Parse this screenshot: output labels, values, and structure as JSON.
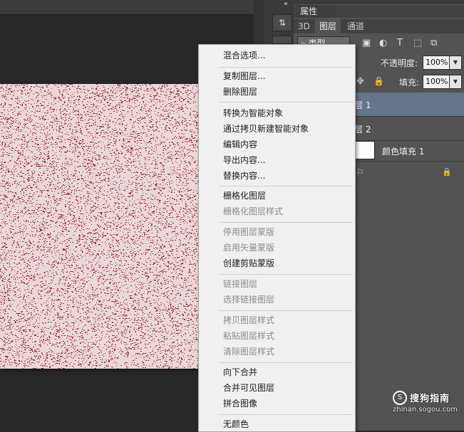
{
  "panel": {
    "props_tab": "属性",
    "tabs": [
      "3D",
      "图层",
      "通道"
    ],
    "filter_label": "类型",
    "opacity_label": "不透明度:",
    "opacity_value": "100%",
    "fill_label": "填充:",
    "fill_value": "100%",
    "layers": [
      "层 1",
      "层 2",
      "颜色填充 1"
    ]
  },
  "context_menu": {
    "items": [
      {
        "label": "混合选项...",
        "enabled": true
      },
      {
        "label": "复制图层...",
        "enabled": true
      },
      {
        "label": "删除图层",
        "enabled": true
      },
      {
        "label": "转换为智能对象",
        "enabled": true
      },
      {
        "label": "通过拷贝新建智能对象",
        "enabled": true
      },
      {
        "label": "编辑内容",
        "enabled": true
      },
      {
        "label": "导出内容...",
        "enabled": true
      },
      {
        "label": "替换内容...",
        "enabled": true
      },
      {
        "label": "栅格化图层",
        "enabled": true
      },
      {
        "label": "栅格化图层样式",
        "enabled": false
      },
      {
        "label": "停用图层蒙版",
        "enabled": false
      },
      {
        "label": "启用矢量蒙版",
        "enabled": false
      },
      {
        "label": "创建剪贴蒙版",
        "enabled": true
      },
      {
        "label": "链接图层",
        "enabled": false
      },
      {
        "label": "选择链接图层",
        "enabled": false
      },
      {
        "label": "拷贝图层样式",
        "enabled": false
      },
      {
        "label": "粘贴图层样式",
        "enabled": false
      },
      {
        "label": "清除图层样式",
        "enabled": false
      },
      {
        "label": "向下合并",
        "enabled": true
      },
      {
        "label": "合并可见图层",
        "enabled": true
      },
      {
        "label": "拼合图像",
        "enabled": true
      },
      {
        "label": "无颜色",
        "enabled": true
      }
    ]
  },
  "watermark": {
    "title": "搜狗指南",
    "url": "zhinan.sogou.com"
  },
  "colors": {
    "noise_dark": "#a8323e",
    "noise_light": "#f3e6e7",
    "selected_layer": "#65758a",
    "menu_bg": "#f0f0f0"
  },
  "icons": [
    "collapse-arrows-icon",
    "history-icon",
    "search-icon",
    "image-filter-icon",
    "adjustment-filter-icon",
    "type-filter-icon",
    "shape-filter-icon",
    "smart-object-filter-icon",
    "move-lock-icon",
    "lock-icon",
    "effects-icon"
  ]
}
